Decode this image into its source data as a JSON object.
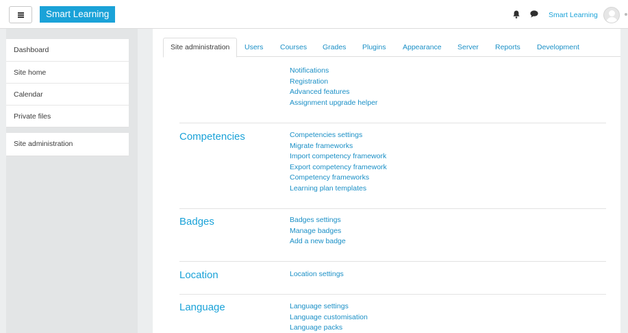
{
  "navbar": {
    "brand": "Smart Learning",
    "user_name": "Smart Learning"
  },
  "drawer": {
    "items": [
      "Dashboard",
      "Site home",
      "Calendar",
      "Private files"
    ],
    "admin_item": "Site administration"
  },
  "tabs": [
    "Site administration",
    "Users",
    "Courses",
    "Grades",
    "Plugins",
    "Appearance",
    "Server",
    "Reports",
    "Development"
  ],
  "sections": {
    "general": {
      "links": [
        "Notifications",
        "Registration",
        "Advanced features",
        "Assignment upgrade helper"
      ]
    },
    "competencies": {
      "heading": "Competencies",
      "links": [
        "Competencies settings",
        "Migrate frameworks",
        "Import competency framework",
        "Export competency framework",
        "Competency frameworks",
        "Learning plan templates"
      ]
    },
    "badges": {
      "heading": "Badges",
      "links": [
        "Badges settings",
        "Manage badges",
        "Add a new badge"
      ]
    },
    "location": {
      "heading": "Location",
      "links": [
        "Location settings"
      ]
    },
    "language": {
      "heading": "Language",
      "links": [
        "Language settings",
        "Language customisation",
        "Language packs"
      ]
    }
  },
  "colors": {
    "brand": "#1aa2d8",
    "link": "#1a8fc6",
    "background": "#eceeef"
  },
  "icons": [
    "menu-icon",
    "bell-icon",
    "chat-icon",
    "avatar-icon"
  ]
}
